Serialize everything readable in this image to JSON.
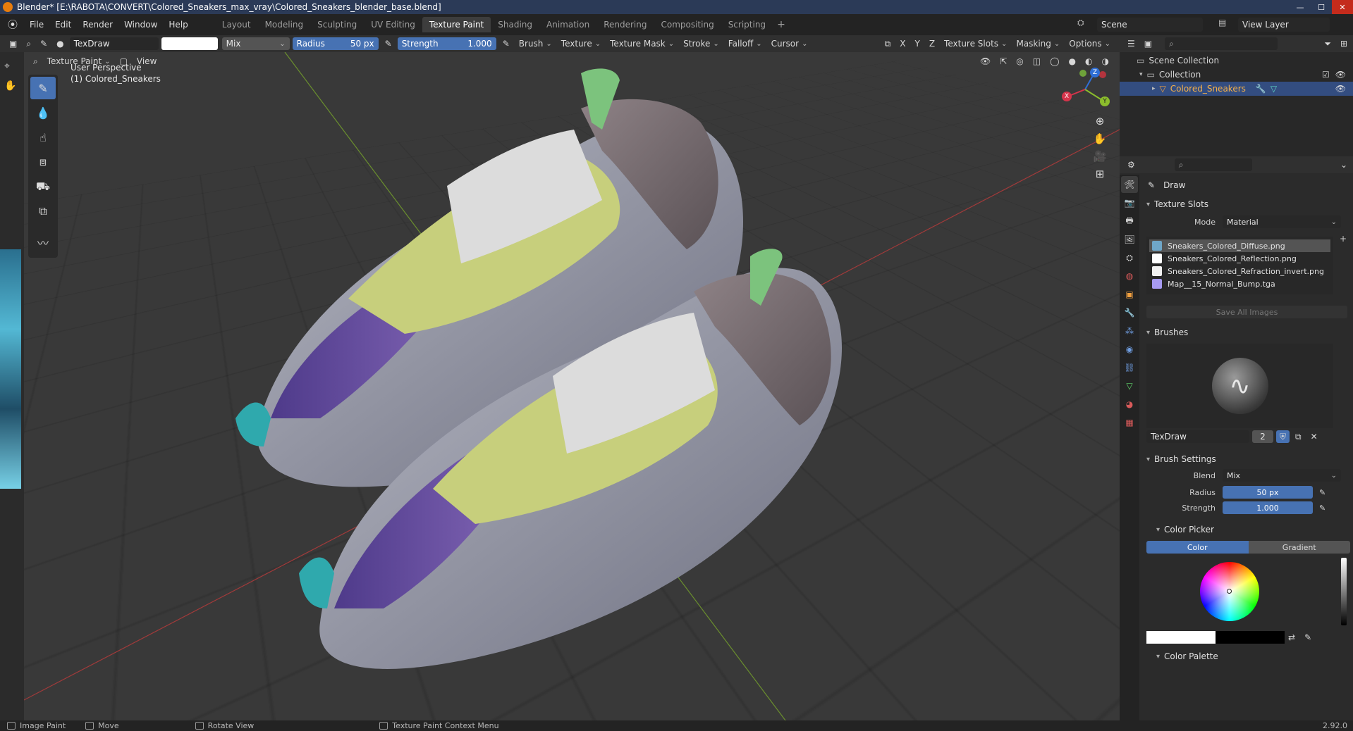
{
  "window": {
    "title": "Blender* [E:\\RABOTA\\CONVERT\\Colored_Sneakers_max_vray\\Colored_Sneakers_blender_base.blend]",
    "minimize_glyph": "—",
    "maximize_glyph": "☐",
    "close_glyph": "✕"
  },
  "menus": [
    "File",
    "Edit",
    "Render",
    "Window",
    "Help"
  ],
  "workspaces": [
    "Layout",
    "Modeling",
    "Sculpting",
    "UV Editing",
    "Texture Paint",
    "Shading",
    "Animation",
    "Rendering",
    "Compositing",
    "Scripting"
  ],
  "active_workspace": "Texture Paint",
  "scene": {
    "name": "Scene",
    "view_layer": "View Layer"
  },
  "tool_header": {
    "brush_name": "TexDraw",
    "color": "#ffffff",
    "blend": "Mix",
    "radius_label": "Radius",
    "radius_value": "50 px",
    "strength_label": "Strength",
    "strength_value": "1.000",
    "menus": [
      "Brush",
      "Texture",
      "Texture Mask",
      "Stroke",
      "Falloff",
      "Cursor"
    ],
    "axes": [
      "X",
      "Y",
      "Z"
    ],
    "right_menus": [
      "Texture Slots",
      "Masking",
      "Options"
    ]
  },
  "viewport_header": {
    "mode": "Texture Paint",
    "view_menu": "View"
  },
  "viewport": {
    "perspective_label": "User Perspective",
    "object_label": "(1) Colored_Sneakers",
    "gizmo_axes": [
      "Z",
      "Y",
      "X"
    ]
  },
  "outliner": {
    "scene_collection": "Scene Collection",
    "collection": "Collection",
    "object": "Colored_Sneakers"
  },
  "properties": {
    "active_tool": "Draw",
    "texture_slots_title": "Texture Slots",
    "mode_label": "Mode",
    "mode_value": "Material",
    "slots": [
      {
        "name": "Sneakers_Colored_Diffuse.png",
        "color": "#6fa6c8"
      },
      {
        "name": "Sneakers_Colored_Reflection.png",
        "color": "#ffffff"
      },
      {
        "name": "Sneakers_Colored_Refraction_invert.png",
        "color": "#f2f2f2"
      },
      {
        "name": "Map__15_Normal_Bump.tga",
        "color": "#a79bf2"
      }
    ],
    "save_all": "Save All Images",
    "brushes_title": "Brushes",
    "brush_name": "TexDraw",
    "brush_users": "2",
    "brush_settings_title": "Brush Settings",
    "blend_label": "Blend",
    "blend_value": "Mix",
    "radius_label": "Radius",
    "radius_value": "50 px",
    "strength_label": "Strength",
    "strength_value": "1.000",
    "color_picker_title": "Color Picker",
    "color_tab": "Color",
    "gradient_tab": "Gradient",
    "color_palette_title": "Color Palette"
  },
  "statusbar": {
    "items": [
      "Image Paint",
      "Move",
      "Rotate View",
      "Texture Paint Context Menu"
    ],
    "version": "2.92.0"
  }
}
